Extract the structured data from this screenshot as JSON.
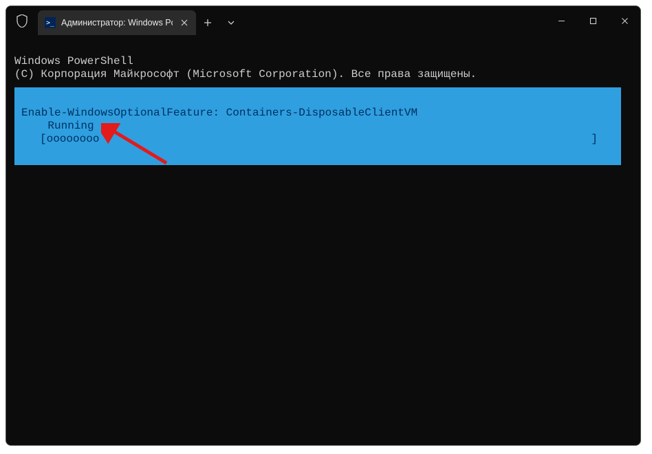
{
  "tab": {
    "title": "Администратор: Windows Po",
    "icon_glyph": ">_"
  },
  "header": {
    "line1": "Windows PowerShell",
    "line2": "(C) Корпорация Майкрософт (Microsoft Corporation). Все права защищены."
  },
  "progress": {
    "title": "Enable-WindowsOptionalFeature: Containers-DisposableClientVM",
    "status": "    Running",
    "bar_open": "[oooooooo",
    "bar_close": "]"
  },
  "annotation": {
    "color": "#e21b1b",
    "arrow_name": "red-arrow"
  }
}
